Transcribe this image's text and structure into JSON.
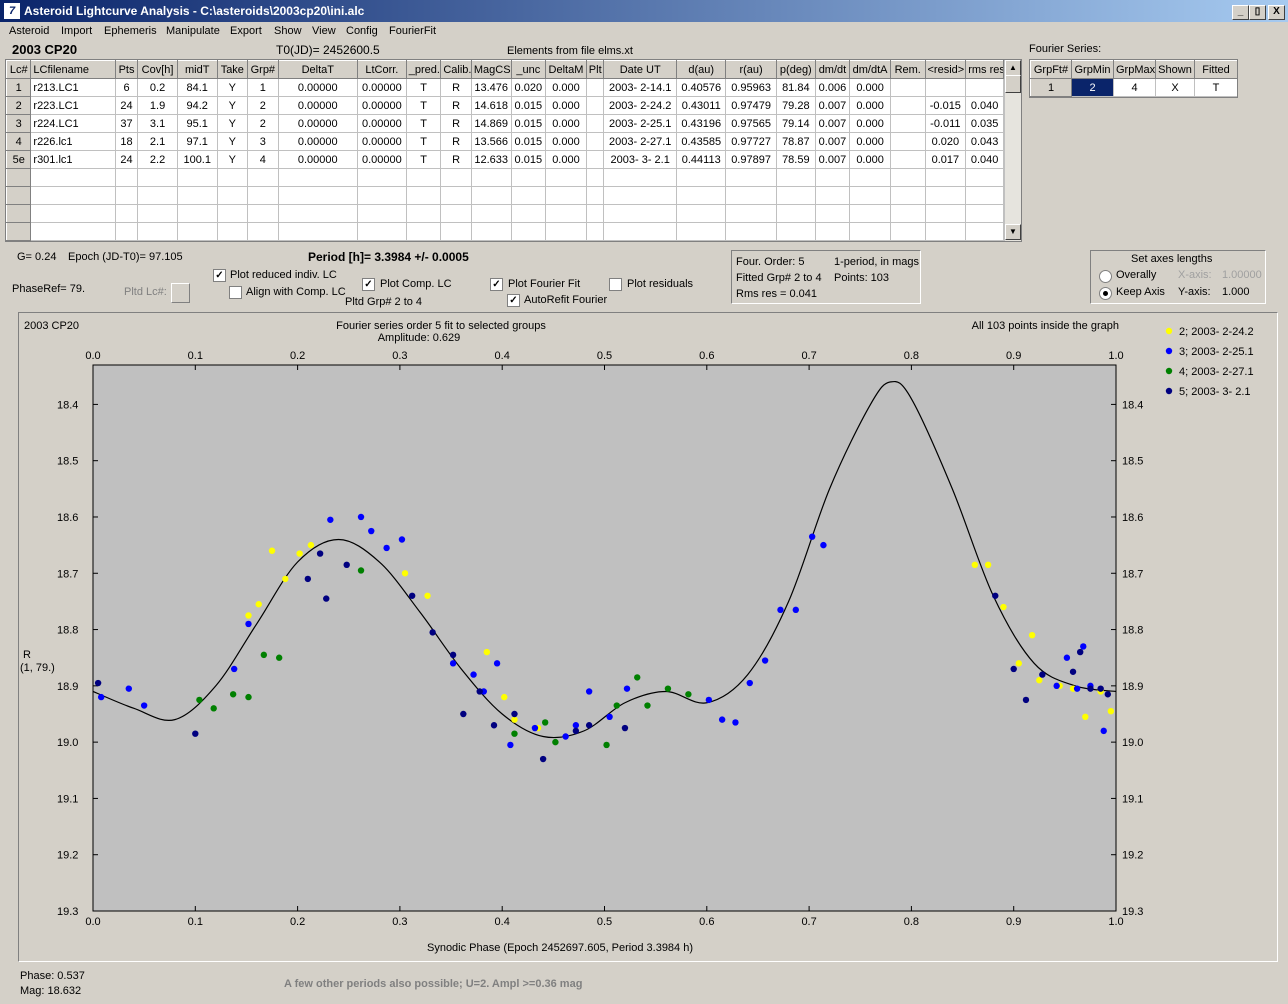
{
  "window": {
    "title": "Asteroid Lightcurve Analysis - C:\\asteroids\\2003cp20\\ini.alc",
    "app_icon_glyph": "7",
    "minimize_glyph": "_",
    "restore_glyph": "▯",
    "close_glyph": "X"
  },
  "menu": [
    "Asteroid",
    "Import",
    "Ephemeris",
    "Manipulate",
    "Export",
    "Show",
    "View",
    "Config",
    "FourierFit"
  ],
  "header": {
    "asteroid": "2003 CP20",
    "t0": "T0(JD)= 2452600.5",
    "elements": "Elements from file elms.xt",
    "fourier_series_label": "Fourier Series:"
  },
  "lc_table": {
    "columns": [
      "Lc#",
      "LCfilename",
      "Pts",
      "Cov[h]",
      "midT",
      "Take",
      "Grp#",
      "DeltaT",
      "LtCorr.",
      "_pred.",
      "Calib.",
      "MagCS",
      "_unc",
      "DeltaM",
      "Plt",
      "Date UT",
      "d(au)",
      "r(au)",
      "p(deg)",
      "dm/dt",
      "dm/dtA",
      "Rem.",
      "<resid>",
      "rms res"
    ],
    "rows": [
      [
        "1",
        "r213.LC1",
        "6",
        "0.2",
        "84.1",
        "Y",
        "1",
        "0.00000",
        "0.00000",
        "T",
        "R",
        "13.476",
        "0.020",
        "0.000",
        "",
        "2003- 2-14.1",
        "0.40576",
        "0.95963",
        "81.84",
        "0.006",
        "0.000",
        "",
        "",
        ""
      ],
      [
        "2",
        "r223.LC1",
        "24",
        "1.9",
        "94.2",
        "Y",
        "2",
        "0.00000",
        "0.00000",
        "T",
        "R",
        "14.618",
        "0.015",
        "0.000",
        "",
        "2003- 2-24.2",
        "0.43011",
        "0.97479",
        "79.28",
        "0.007",
        "0.000",
        "",
        "-0.015",
        "0.040"
      ],
      [
        "3",
        "r224.LC1",
        "37",
        "3.1",
        "95.1",
        "Y",
        "2",
        "0.00000",
        "0.00000",
        "T",
        "R",
        "14.869",
        "0.015",
        "0.000",
        "",
        "2003- 2-25.1",
        "0.43196",
        "0.97565",
        "79.14",
        "0.007",
        "0.000",
        "",
        "-0.011",
        "0.035"
      ],
      [
        "4",
        "r226.lc1",
        "18",
        "2.1",
        "97.1",
        "Y",
        "3",
        "0.00000",
        "0.00000",
        "T",
        "R",
        "13.566",
        "0.015",
        "0.000",
        "",
        "2003- 2-27.1",
        "0.43585",
        "0.97727",
        "78.87",
        "0.007",
        "0.000",
        "",
        "0.020",
        "0.043"
      ],
      [
        "5e",
        "r301.lc1",
        "24",
        "2.2",
        "100.1",
        "Y",
        "4",
        "0.00000",
        "0.00000",
        "T",
        "R",
        "12.633",
        "0.015",
        "0.000",
        "",
        "2003- 3- 2.1",
        "0.44113",
        "0.97897",
        "78.59",
        "0.007",
        "0.000",
        "",
        "0.017",
        "0.040"
      ]
    ],
    "scroll_up_glyph": "▲",
    "scroll_down_glyph": "▼"
  },
  "fourier_table": {
    "columns": [
      "GrpFt#",
      "GrpMin",
      "GrpMax",
      "Shown",
      "Fitted"
    ],
    "rows": [
      [
        "1",
        "2",
        "4",
        "X",
        "T"
      ]
    ]
  },
  "controls": {
    "g_label": "G= 0.24",
    "epoch_label": "Epoch (JD-T0)= 97.105",
    "phaseref_label": "PhaseRef= 79.",
    "pltd_lc_label": "Pltd Lc#:",
    "period_label": "Period [h]= 3.3984 +/- 0.0005",
    "plot_reduced": "Plot reduced indiv. LC",
    "align_comp": "Align with Comp. LC",
    "plot_comp": "Plot Comp. LC",
    "pltd_grp": "Pltd Grp#  2   to   4",
    "plot_fourier": "Plot Fourier Fit",
    "autorefit": "AutoRefit Fourier",
    "plot_residuals": "Plot residuals",
    "check_mark": "✓",
    "checked": {
      "plot_reduced": true,
      "align_comp": false,
      "plot_comp": true,
      "plot_fourier": true,
      "autorefit": true,
      "plot_residuals": false
    }
  },
  "fit_info": {
    "order": "Four. Order:  5",
    "period_mode": "1-period, in mags",
    "fitted": "Fitted Grp# 2 to 4",
    "points": "Points: 103",
    "rms": "Rms res     = 0.041"
  },
  "axes_box": {
    "title": "Set axes lengths",
    "overall": "Overally",
    "keep": "Keep Axis",
    "xaxis_label": "X-axis:",
    "xaxis_val": "1.00000",
    "yaxis_label": "Y-axis:",
    "yaxis_val": "1.000",
    "selected": "keep"
  },
  "plot": {
    "object": "2003 CP20",
    "title1": "Fourier series order 5 fit to selected groups",
    "title2": "Amplitude: 0.629",
    "points_note": "All 103 points inside the graph",
    "ylabel1": "R",
    "ylabel2": "(1, 79.)",
    "xlabel": "Synodic Phase (Epoch 2452697.605, Period 3.3984 h)",
    "background": "#c0c0c0"
  },
  "chart_data": {
    "type": "scatter",
    "title": "Fourier series order 5 fit to selected groups",
    "xlabel": "Synodic Phase (Epoch 2452697.605, Period 3.3984 h)",
    "ylabel": "R",
    "xlim": [
      0,
      1
    ],
    "ylim": [
      19.3,
      18.33
    ],
    "y_inverted": true,
    "xticks": [
      "0.0",
      "0.1",
      "0.2",
      "0.3",
      "0.4",
      "0.5",
      "0.6",
      "0.7",
      "0.8",
      "0.9",
      "1.0"
    ],
    "yticks": [
      "18.4",
      "18.5",
      "18.6",
      "18.7",
      "18.8",
      "18.9",
      "19.0",
      "19.1",
      "19.2",
      "19.3"
    ],
    "legend_position": "right",
    "series": [
      {
        "name": "2; 2003- 2-24.2",
        "color": "#ffff00",
        "x": [
          0.152,
          0.162,
          0.175,
          0.188,
          0.202,
          0.213,
          0.305,
          0.327,
          0.385,
          0.402,
          0.412,
          0.435,
          0.862,
          0.875,
          0.89,
          0.905,
          0.918,
          0.925,
          0.945,
          0.958,
          0.97,
          0.985,
          0.995
        ],
        "y": [
          18.775,
          18.755,
          18.66,
          18.71,
          18.665,
          18.65,
          18.7,
          18.74,
          18.84,
          18.92,
          18.96,
          18.975,
          18.685,
          18.685,
          18.76,
          18.86,
          18.81,
          18.89,
          18.9,
          18.905,
          18.955,
          18.91,
          18.945
        ]
      },
      {
        "name": "3; 2003- 2-25.1",
        "color": "#0000ff",
        "x": [
          0.008,
          0.035,
          0.05,
          0.138,
          0.152,
          0.232,
          0.262,
          0.272,
          0.287,
          0.302,
          0.352,
          0.372,
          0.382,
          0.395,
          0.408,
          0.432,
          0.462,
          0.472,
          0.485,
          0.505,
          0.522,
          0.602,
          0.615,
          0.628,
          0.642,
          0.657,
          0.672,
          0.687,
          0.703,
          0.714,
          0.942,
          0.952,
          0.962,
          0.968,
          0.975,
          0.988
        ],
        "y": [
          18.92,
          18.905,
          18.935,
          18.87,
          18.79,
          18.605,
          18.6,
          18.625,
          18.655,
          18.64,
          18.86,
          18.88,
          18.91,
          18.86,
          19.005,
          18.975,
          18.99,
          18.97,
          18.91,
          18.955,
          18.905,
          18.925,
          18.96,
          18.965,
          18.895,
          18.855,
          18.765,
          18.765,
          18.635,
          18.65,
          18.9,
          18.85,
          18.905,
          18.83,
          18.9,
          18.98
        ]
      },
      {
        "name": "4; 2003- 2-27.1",
        "color": "#008000",
        "x": [
          0.104,
          0.118,
          0.137,
          0.152,
          0.167,
          0.182,
          0.262,
          0.412,
          0.442,
          0.452,
          0.502,
          0.512,
          0.532,
          0.542,
          0.562,
          0.582
        ],
        "y": [
          18.925,
          18.94,
          18.915,
          18.92,
          18.845,
          18.85,
          18.695,
          18.985,
          18.965,
          19.0,
          19.005,
          18.935,
          18.885,
          18.935,
          18.905,
          18.915
        ]
      },
      {
        "name": "5; 2003- 3- 2.1",
        "color": "#000080",
        "x": [
          0.005,
          0.1,
          0.21,
          0.222,
          0.228,
          0.248,
          0.312,
          0.332,
          0.352,
          0.362,
          0.378,
          0.392,
          0.412,
          0.44,
          0.472,
          0.485,
          0.52,
          0.882,
          0.9,
          0.912,
          0.928,
          0.958,
          0.965,
          0.975,
          0.985,
          0.992
        ],
        "y": [
          18.895,
          18.985,
          18.71,
          18.665,
          18.745,
          18.685,
          18.74,
          18.805,
          18.845,
          18.95,
          18.91,
          18.97,
          18.95,
          19.03,
          18.98,
          18.97,
          18.975,
          18.74,
          18.87,
          18.925,
          18.88,
          18.875,
          18.84,
          18.905,
          18.905,
          18.915
        ]
      }
    ],
    "fit_curve": {
      "name": "Fourier fit",
      "x": [
        0.0,
        0.04,
        0.08,
        0.12,
        0.16,
        0.2,
        0.24,
        0.28,
        0.32,
        0.36,
        0.4,
        0.44,
        0.48,
        0.52,
        0.56,
        0.6,
        0.64,
        0.68,
        0.72,
        0.76,
        0.78,
        0.8,
        0.84,
        0.88,
        0.92,
        0.96,
        1.0
      ],
      "y": [
        18.91,
        18.94,
        18.96,
        18.9,
        18.79,
        18.68,
        18.64,
        18.68,
        18.77,
        18.87,
        18.95,
        18.99,
        18.98,
        18.93,
        18.91,
        18.93,
        18.88,
        18.75,
        18.55,
        18.4,
        18.36,
        18.39,
        18.55,
        18.74,
        18.86,
        18.9,
        18.91
      ]
    }
  },
  "status": {
    "phase": "Phase:  0.537",
    "mag": "Mag:    18.632",
    "note": "A few other periods also possible; U=2. Ampl >=0.36 mag"
  }
}
